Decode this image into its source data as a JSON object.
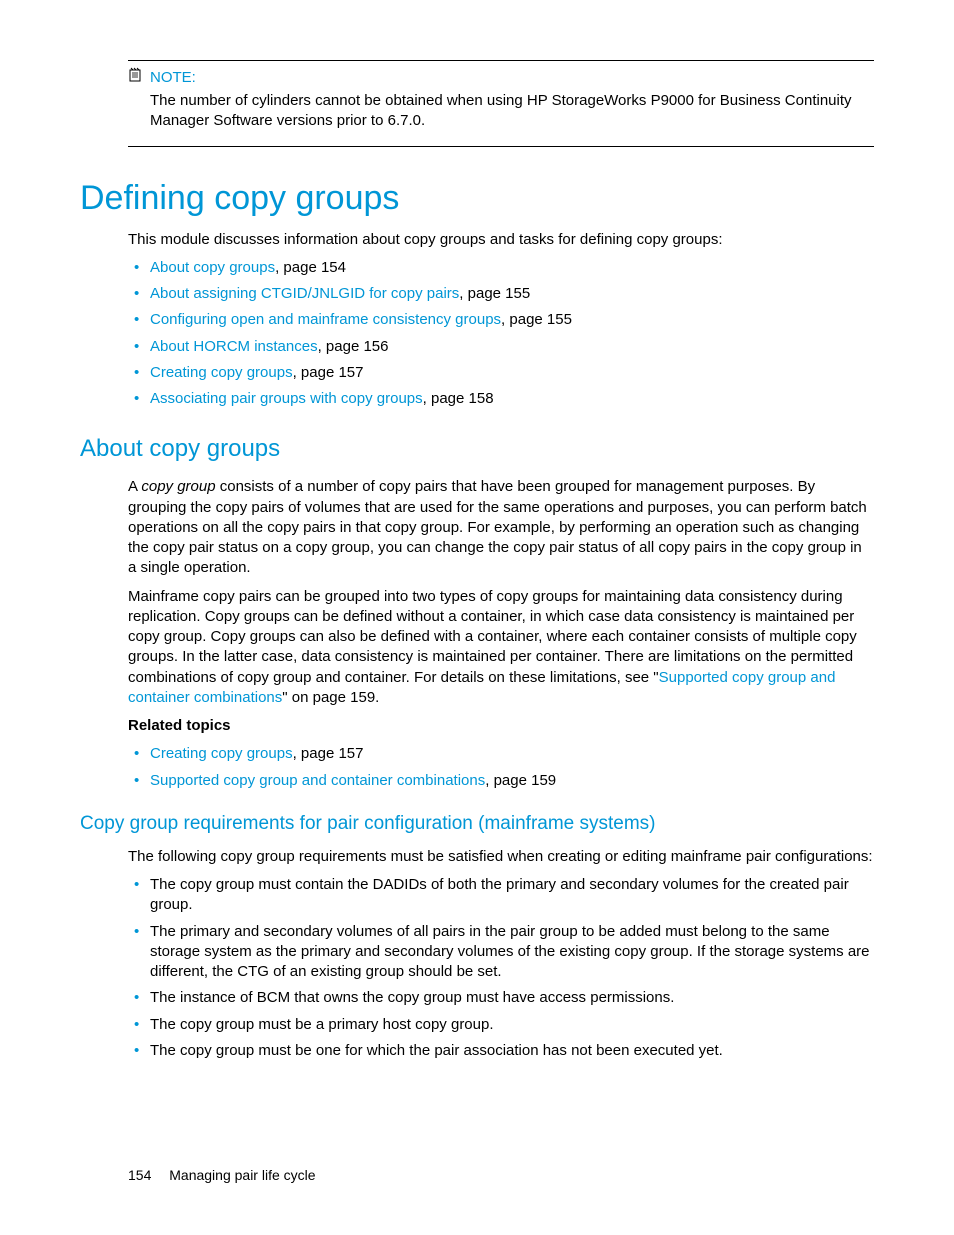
{
  "note": {
    "label": "NOTE:",
    "body": "The number of cylinders cannot be obtained when using HP StorageWorks P9000 for Business Continuity Manager Software versions prior to 6.7.0."
  },
  "h1": "Defining copy groups",
  "intro": "This module discusses information about copy groups and tasks for defining copy groups:",
  "toc": [
    {
      "link": "About copy groups",
      "suffix": ", page 154"
    },
    {
      "link": "About assigning CTGID/JNLGID for copy pairs",
      "suffix": ", page 155"
    },
    {
      "link": "Configuring open and mainframe consistency groups",
      "suffix": ", page 155"
    },
    {
      "link": "About HORCM instances",
      "suffix": ", page 156"
    },
    {
      "link": "Creating copy groups",
      "suffix": ", page 157"
    },
    {
      "link": "Associating pair groups with copy groups",
      "suffix": ", page 158"
    }
  ],
  "h2_about": "About copy groups",
  "about_p1_pre": "A ",
  "about_p1_em": "copy group",
  "about_p1_post": " consists of a number of copy pairs that have been grouped for management purposes. By grouping the copy pairs of volumes that are used for the same operations and purposes, you can perform batch operations on all the copy pairs in that copy group. For example, by performing an operation such as changing the copy pair status on a copy group, you can change the copy pair status of all copy pairs in the copy group in a single operation.",
  "about_p2_pre": "Mainframe copy pairs can be grouped into two types of copy groups for maintaining data consistency during replication. Copy groups can be defined without a container, in which case data consistency is maintained per copy group. Copy groups can also be defined with a container, where each container consists of multiple copy groups. In the latter case, data consistency is maintained per container. There are limitations on the permitted combinations of copy group and container. For details on these limitations, see \"",
  "about_p2_link": "Supported copy group and container combinations",
  "about_p2_post": "\" on page 159.",
  "related_label": "Related topics",
  "related": [
    {
      "link": "Creating copy groups",
      "suffix": ", page 157"
    },
    {
      "link": "Supported copy group and container combinations",
      "suffix": ", page 159"
    }
  ],
  "h3_req": "Copy group requirements for pair configuration (mainframe systems)",
  "req_intro": "The following copy group requirements must be satisfied when creating or editing mainframe pair configurations:",
  "req_items": [
    "The copy group must contain the DADIDs of both the primary and secondary volumes for the created pair group.",
    "The primary and secondary volumes of all pairs in the pair group to be added must belong to the same storage system as the primary and secondary volumes of the existing copy group. If the storage systems are different, the CTG of an existing group should be set.",
    "The instance of BCM that owns the copy group must have access permissions.",
    "The copy group must be a primary host copy group.",
    "The copy group must be one for which the pair association has not been executed yet."
  ],
  "footer": {
    "page": "154",
    "title": "Managing pair life cycle"
  }
}
